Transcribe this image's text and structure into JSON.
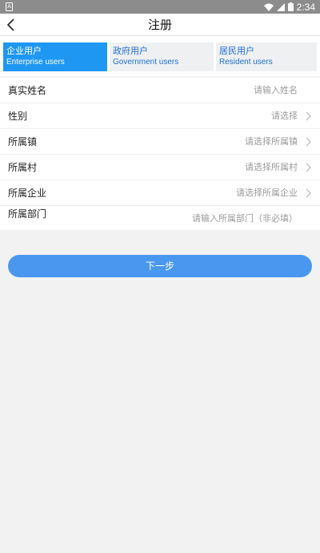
{
  "status_bar": {
    "sim_label": "A",
    "time": "2:34"
  },
  "header": {
    "title": "注册"
  },
  "user_tabs": [
    {
      "zh": "企业用户",
      "en": "Enterprise users",
      "active": true
    },
    {
      "zh": "政府用户",
      "en": "Government users",
      "active": false
    },
    {
      "zh": "居民用户",
      "en": "Resident users",
      "active": false
    }
  ],
  "form": {
    "real_name": {
      "label": "真实姓名",
      "placeholder": "请输入姓名"
    },
    "gender": {
      "label": "性别",
      "placeholder": "请选择"
    },
    "town": {
      "label": "所属镇",
      "placeholder": "请选择所属镇"
    },
    "village": {
      "label": "所属村",
      "placeholder": "请选择所属村"
    },
    "enterprise": {
      "label": "所属企业",
      "placeholder": "请选择所属企业"
    },
    "department": {
      "label": "所属部门",
      "placeholder": "请输入所属部门（非必填）"
    }
  },
  "next_button": {
    "label": "下一步"
  },
  "colors": {
    "accent": "#1e97f3",
    "button": "#4a97f0",
    "status_bar": "#8c8c8c",
    "background": "#f2f2f3"
  }
}
